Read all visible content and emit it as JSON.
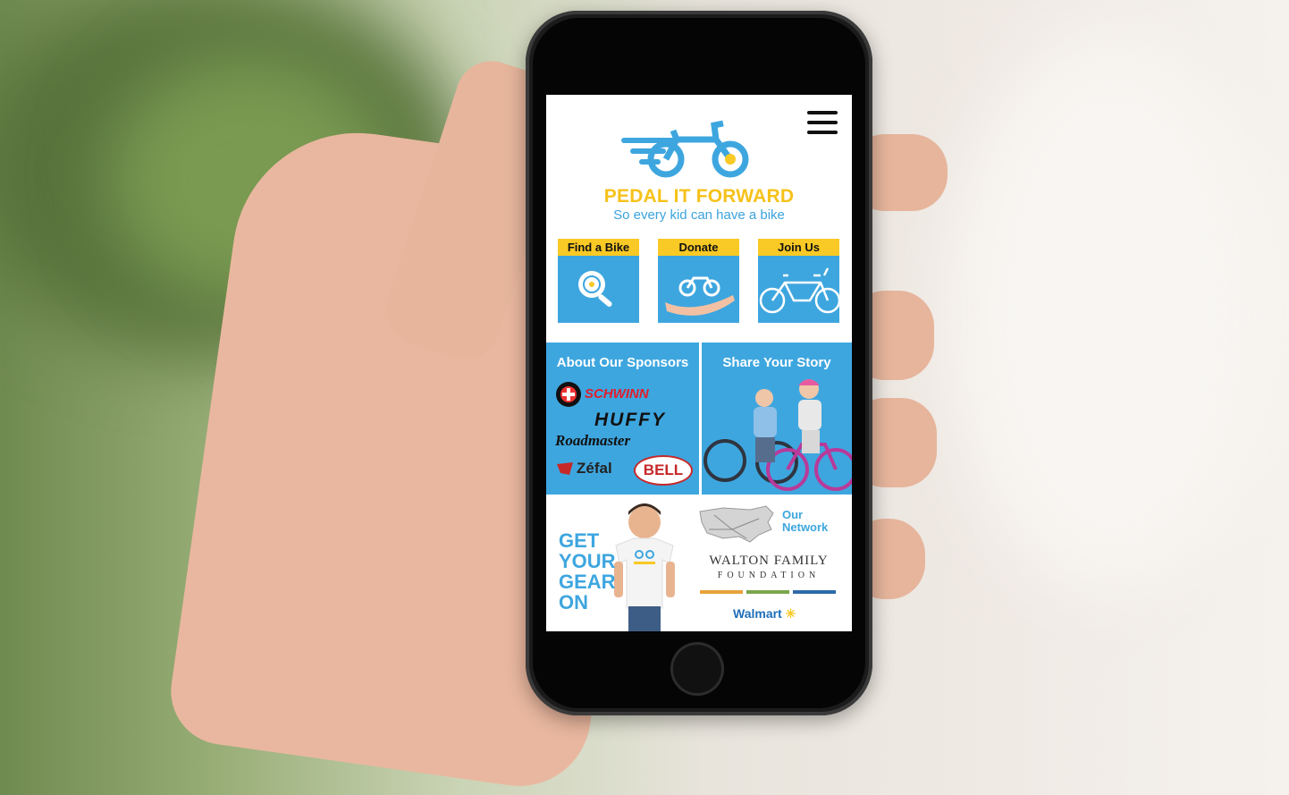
{
  "brand": {
    "name": "PEDAL IT FORWARD",
    "tagline": "So every kid can have a bike"
  },
  "tiles": [
    {
      "label": "Find a Bike",
      "icon": "magnifier-wheel-icon"
    },
    {
      "label": "Donate",
      "icon": "hand-bike-icon"
    },
    {
      "label": "Join Us",
      "icon": "tandem-bike-icon"
    }
  ],
  "sponsors": {
    "title": "About Our Sponsors",
    "logos": [
      "SCHWINN",
      "HUFFY",
      "Roadmaster",
      "Zéfal",
      "BELL"
    ]
  },
  "story": {
    "title": "Share Your Story"
  },
  "gear": {
    "line1": "GET",
    "line2": "YOUR",
    "line3": "GEAR",
    "line4": "ON"
  },
  "network": {
    "line1": "Our",
    "line2": "Network",
    "walton_line1": "WALTON FAMILY",
    "walton_line2": "FOUNDATION",
    "walmart": "Walmart"
  },
  "colors": {
    "accent_blue": "#3ea6df",
    "accent_yellow": "#f9c925",
    "brand_yellow": "#f6c21a"
  }
}
